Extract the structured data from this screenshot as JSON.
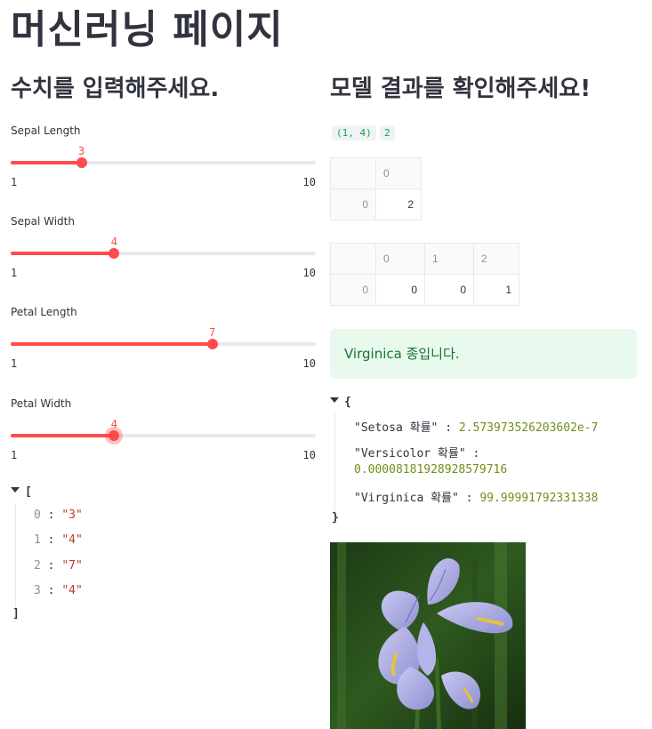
{
  "page": {
    "title": "머신러닝 페이지"
  },
  "input_column": {
    "subheader": "수치를 입력해주세요.",
    "sliders": [
      {
        "label": "Sepal Length",
        "value": 3,
        "value_text": "3",
        "min": 1,
        "max": 10,
        "min_text": "1",
        "max_text": "10"
      },
      {
        "label": "Sepal Width",
        "value": 4,
        "value_text": "4",
        "min": 1,
        "max": 10,
        "min_text": "1",
        "max_text": "10"
      },
      {
        "label": "Petal Length",
        "value": 7,
        "value_text": "7",
        "min": 1,
        "max": 10,
        "min_text": "1",
        "max_text": "10"
      },
      {
        "label": "Petal Width",
        "value": 4,
        "value_text": "4",
        "min": 1,
        "max": 10,
        "min_text": "1",
        "max_text": "10",
        "focused": true
      }
    ],
    "json_list": {
      "open": "[",
      "close": "]",
      "items": [
        {
          "index": "0",
          "value": "\"3\""
        },
        {
          "index": "1",
          "value": "\"4\""
        },
        {
          "index": "2",
          "value": "\"7\""
        },
        {
          "index": "3",
          "value": "\"4\""
        }
      ]
    }
  },
  "result_column": {
    "subheader": "모델 결과를 확인해주세요!",
    "code_chips": [
      "(1, 4)",
      "2"
    ],
    "table1": {
      "header": [
        "",
        "0"
      ],
      "rows": [
        [
          "0",
          "2"
        ]
      ]
    },
    "table2": {
      "header": [
        "",
        "0",
        "1",
        "2"
      ],
      "rows": [
        [
          "0",
          "0",
          "0",
          "1"
        ]
      ]
    },
    "success_message": "Virginica 종입니다.",
    "json_object": {
      "open": "{",
      "close": "}",
      "entries": [
        {
          "key": "\"Setosa 확률\"",
          "value": "2.573973526203602e-7"
        },
        {
          "key": "\"Versicolor 확률\"",
          "value": "0.00008181928928579716"
        },
        {
          "key": "\"Virginica 확률\"",
          "value": "99.99991792331338"
        }
      ]
    },
    "image_icon": "iris-flower-photo"
  },
  "colors": {
    "accent": "#ff4b4b",
    "track": "#e6e9ef",
    "success_bg": "#e8f9ee",
    "success_text": "#177233",
    "json_string": "#c0392b",
    "json_number": "#6f8f1a"
  }
}
